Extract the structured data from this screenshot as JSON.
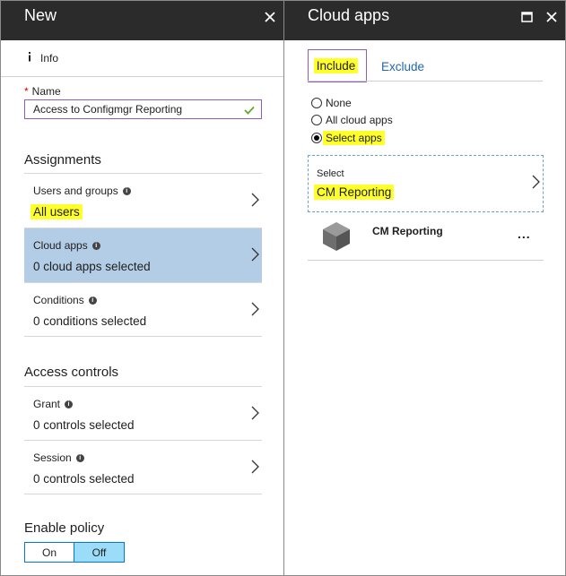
{
  "left_blade": {
    "title": "New",
    "info_label": "Info",
    "name_field": {
      "label": "Name",
      "value": "Access to Configmgr Reporting"
    },
    "assignments": {
      "title": "Assignments",
      "items": [
        {
          "label": "Users and groups",
          "value": "All users"
        },
        {
          "label": "Cloud apps",
          "value": "0 cloud apps selected"
        },
        {
          "label": "Conditions",
          "value": "0 conditions selected"
        }
      ]
    },
    "access_controls": {
      "title": "Access controls",
      "items": [
        {
          "label": "Grant",
          "value": "0 controls selected"
        },
        {
          "label": "Session",
          "value": "0 controls selected"
        }
      ]
    },
    "enable_policy": {
      "title": "Enable policy",
      "on_label": "On",
      "off_label": "Off",
      "selected": "Off"
    }
  },
  "right_blade": {
    "title": "Cloud apps",
    "tabs": {
      "include": "Include",
      "exclude": "Exclude"
    },
    "radio_options": [
      {
        "label": "None",
        "checked": false
      },
      {
        "label": "All cloud apps",
        "checked": false
      },
      {
        "label": "Select apps",
        "checked": true
      }
    ],
    "select": {
      "label": "Select",
      "value": "CM Reporting"
    },
    "apps": [
      {
        "name": "CM Reporting",
        "more": "..."
      }
    ]
  },
  "colors": {
    "header_bg": "#2b2b2b",
    "selected_item_bg": "#b3cde6",
    "highlight": "#ffff2a",
    "toggle_active": "#9bdcf9",
    "link": "#1f66b3",
    "focus_border": "#8e5db5"
  },
  "icons": [
    "close-icon",
    "maximize-icon",
    "info-icon",
    "checkmark-icon",
    "chevron-right-icon",
    "cube-app-icon",
    "more-icon"
  ]
}
